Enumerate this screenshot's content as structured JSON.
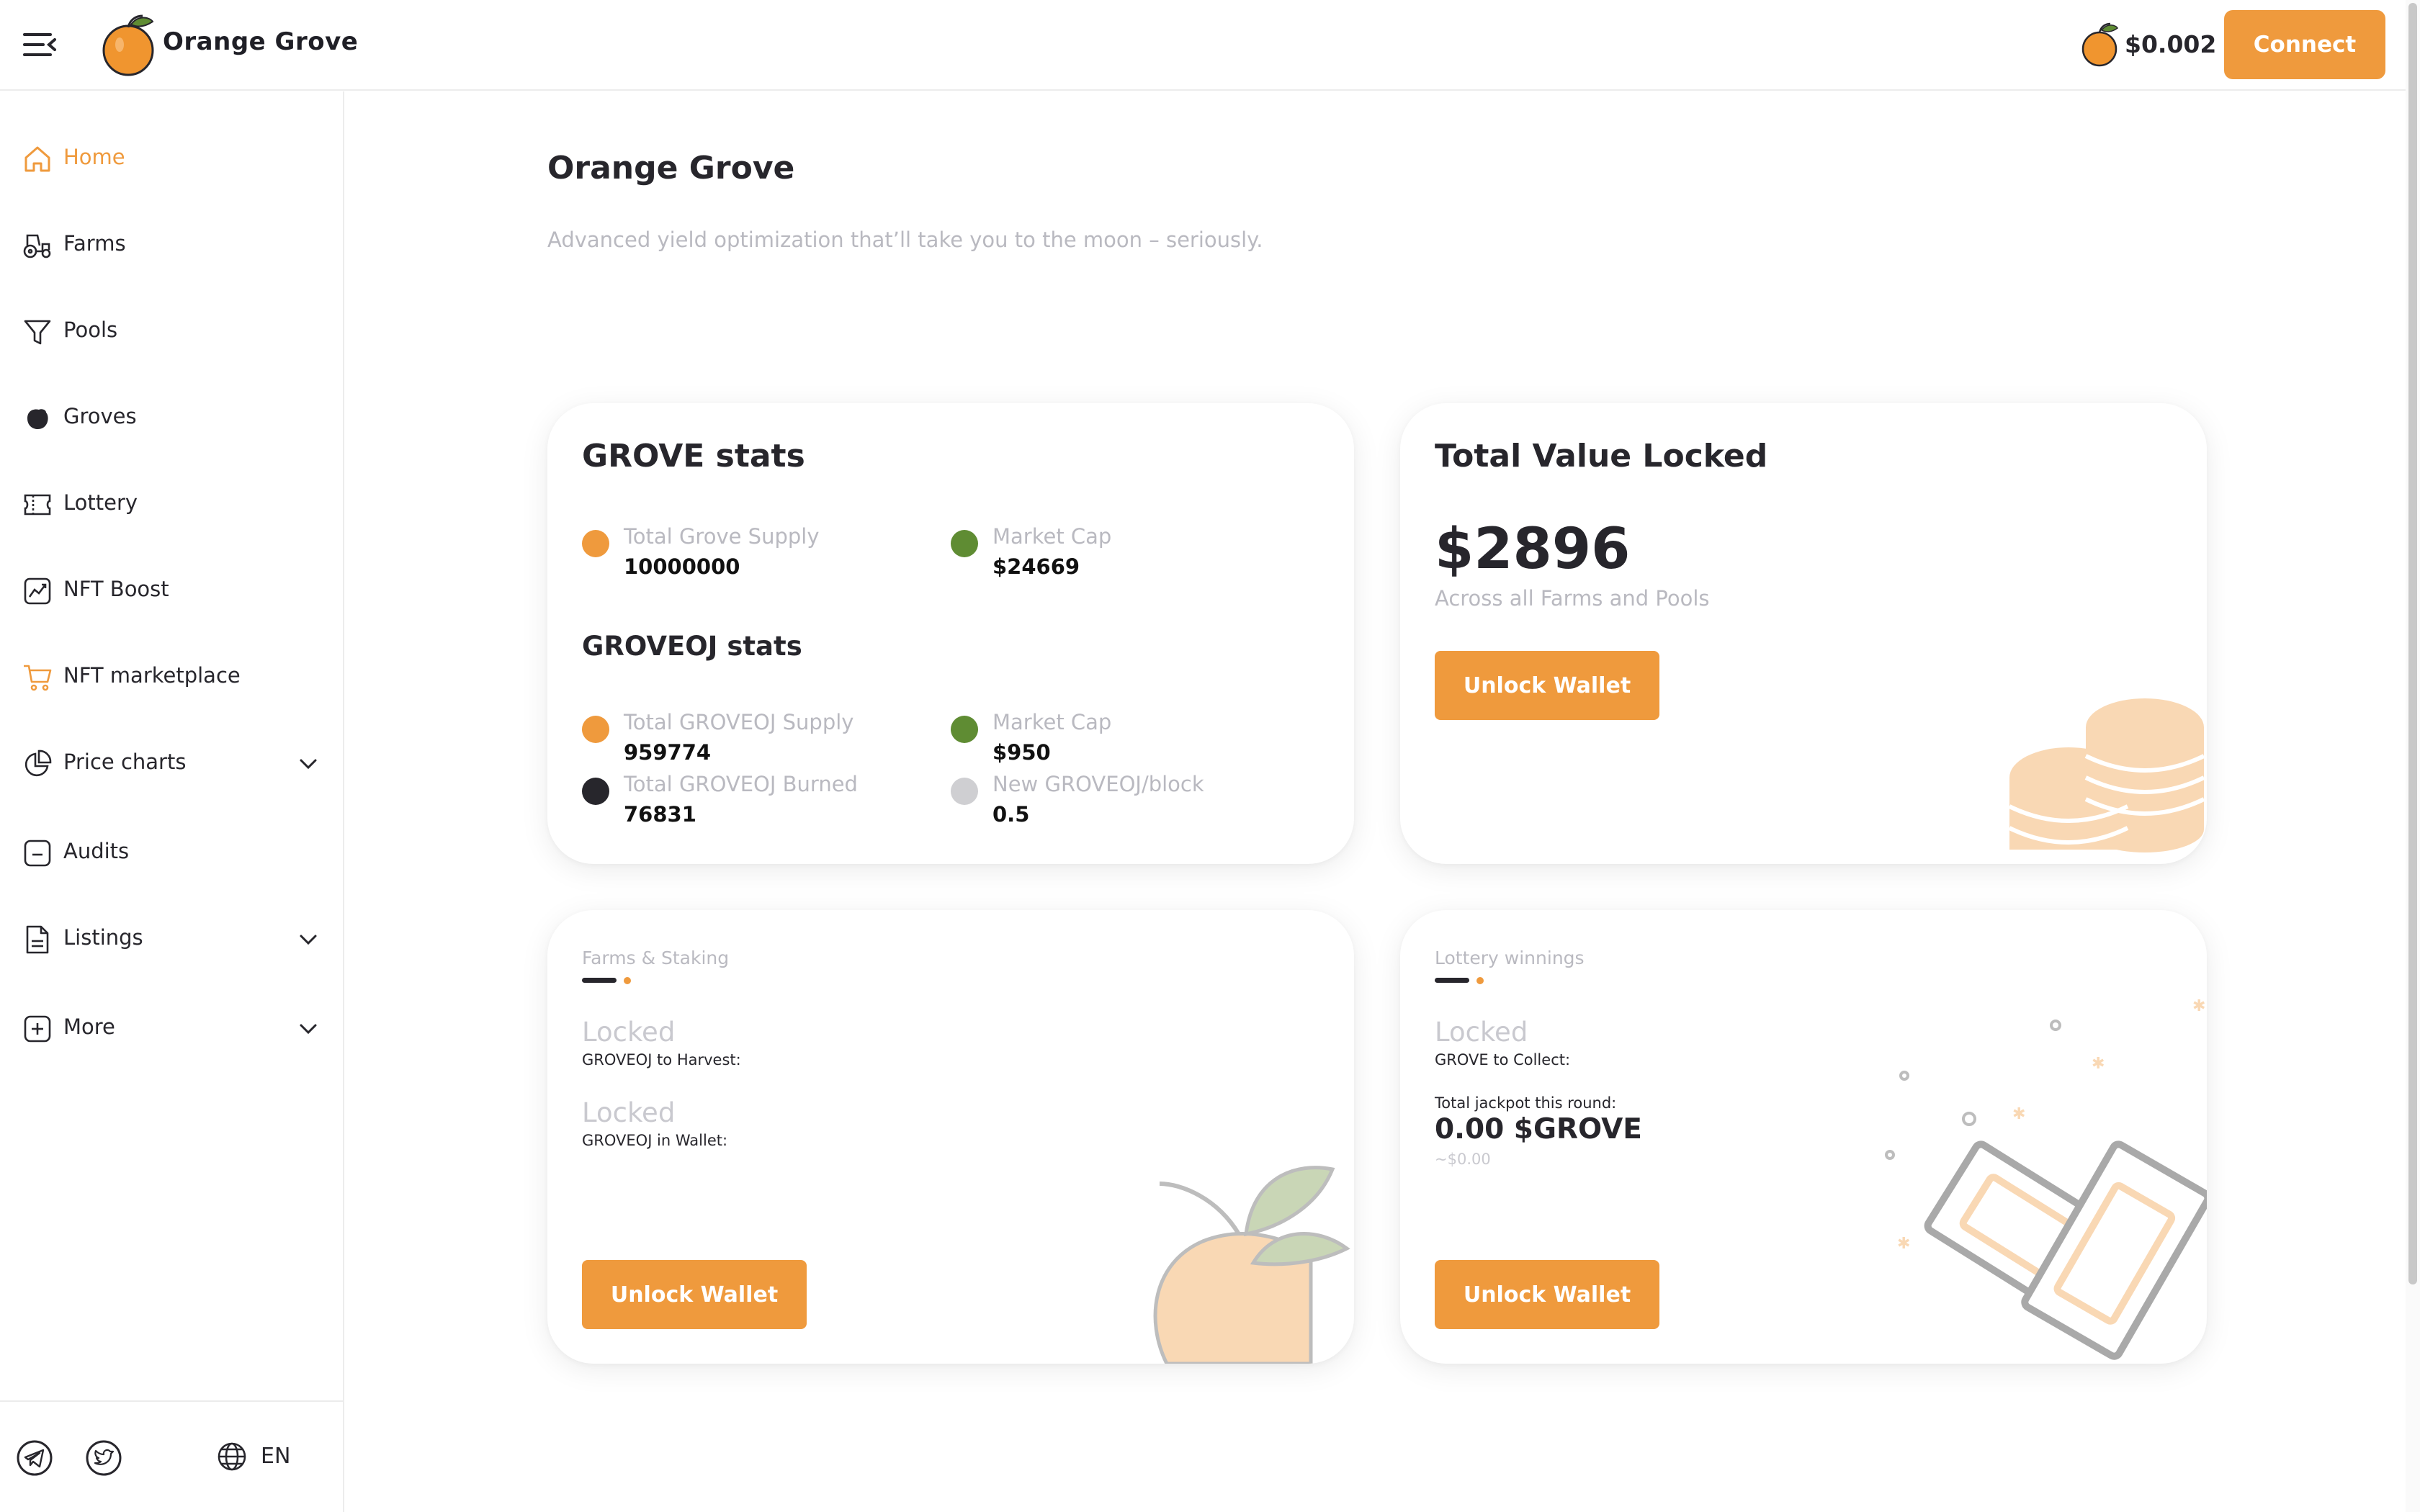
{
  "header": {
    "app_name": "Orange Grove",
    "token_price": "$0.002",
    "connect_label": "Connect"
  },
  "sidebar": {
    "items": [
      {
        "label": "Home",
        "icon": "home-icon",
        "active": true
      },
      {
        "label": "Farms",
        "icon": "tractor-icon"
      },
      {
        "label": "Pools",
        "icon": "funnel-icon"
      },
      {
        "label": "Groves",
        "icon": "orange-icon"
      },
      {
        "label": "Lottery",
        "icon": "ticket-icon"
      },
      {
        "label": "NFT Boost",
        "icon": "chart-icon"
      },
      {
        "label": "NFT marketplace",
        "icon": "cart-icon"
      },
      {
        "label": "Price charts",
        "icon": "pie-chart-icon",
        "expandable": true
      },
      {
        "label": "Audits",
        "icon": "audit-icon"
      },
      {
        "label": "Listings",
        "icon": "document-icon",
        "expandable": true
      },
      {
        "label": "More",
        "icon": "plus-icon",
        "expandable": true
      }
    ],
    "footer": {
      "social": [
        "telegram-icon",
        "twitter-icon"
      ],
      "language": "EN"
    }
  },
  "hero": {
    "title": "Orange Grove",
    "subtitle": "Advanced yield optimization that’ll take you to the moon – seriously."
  },
  "grove_stats": {
    "title": "GROVE stats",
    "items": [
      {
        "label": "Total Grove Supply",
        "value": "10000000",
        "color": "#ef9a3d"
      },
      {
        "label": "Market Cap",
        "value": "$24669",
        "color": "#5f8c33"
      }
    ]
  },
  "groveoj_stats": {
    "title": "GROVEOJ stats",
    "items": [
      {
        "label": "Total GROVEOJ Supply",
        "value": "959774",
        "color": "#ef9a3d"
      },
      {
        "label": "Market Cap",
        "value": "$950",
        "color": "#5f8c33"
      },
      {
        "label": "Total GROVEOJ Burned",
        "value": "76831",
        "color": "#27262c"
      },
      {
        "label": "New GROVEOJ/block",
        "value": "0.5",
        "color": "#cfcfd2"
      }
    ]
  },
  "tvl": {
    "title": "Total Value Locked",
    "value": "$2896",
    "subtitle": "Across all Farms and Pools",
    "button": "Unlock Wallet"
  },
  "farms": {
    "heading": "Farms & Staking",
    "harvest_value": "Locked",
    "harvest_label": "GROVEOJ to Harvest:",
    "wallet_value": "Locked",
    "wallet_label": "GROVEOJ in Wallet:",
    "button": "Unlock Wallet"
  },
  "lottery": {
    "heading": "Lottery winnings",
    "collect_value": "Locked",
    "collect_label": "GROVE to Collect:",
    "jackpot_label": "Total jackpot this round:",
    "jackpot_value": "0.00 $GROVE",
    "jackpot_usd": "~$0.00",
    "button": "Unlock Wallet"
  },
  "colors": {
    "accent": "#ef9a3d",
    "text": "#27262c",
    "muted": "#b9b9c0",
    "green": "#5f8c33"
  }
}
